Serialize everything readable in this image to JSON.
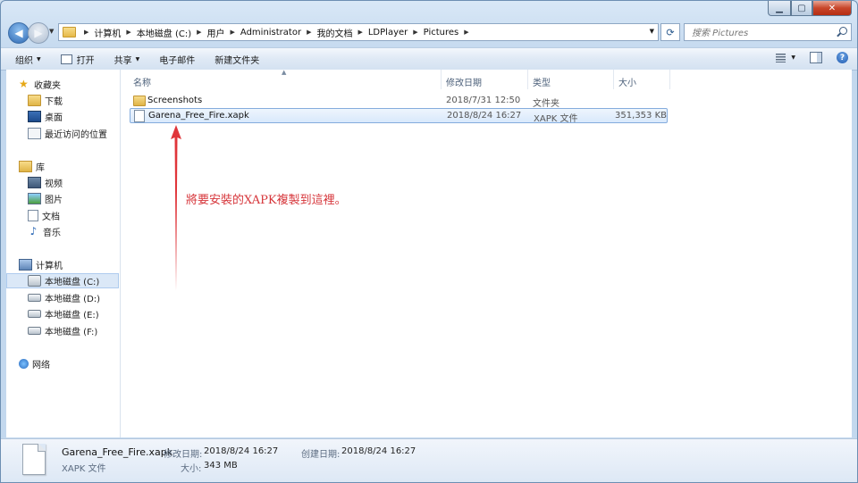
{
  "addressbar": {
    "crumbs": [
      "计算机",
      "本地磁盘 (C:)",
      "用户",
      "Administrator",
      "我的文档",
      "LDPlayer",
      "Pictures"
    ]
  },
  "search": {
    "placeholder": "搜索 Pictures"
  },
  "toolbar": {
    "organize": "组织",
    "open": "打开",
    "share": "共享",
    "email": "电子邮件",
    "new_folder": "新建文件夹"
  },
  "sidebar": {
    "favorites": "收藏夹",
    "downloads": "下载",
    "desktop": "桌面",
    "recent": "最近访问的位置",
    "libraries": "库",
    "videos": "视频",
    "pictures": "图片",
    "documents": "文档",
    "music": "音乐",
    "computer": "计算机",
    "drive_c": "本地磁盘 (C:)",
    "drive_d": "本地磁盘 (D:)",
    "drive_e": "本地磁盘 (E:)",
    "drive_f": "本地磁盘 (F:)",
    "network": "网络"
  },
  "columns": {
    "name": "名称",
    "date": "修改日期",
    "type": "类型",
    "size": "大小"
  },
  "files": [
    {
      "name": "Screenshots",
      "date": "2018/7/31 12:50",
      "type": "文件夹",
      "size": ""
    },
    {
      "name": "Garena_Free_Fire.xapk",
      "date": "2018/8/24 16:27",
      "type": "XAPK 文件",
      "size": "351,353 KB"
    }
  ],
  "annotation": "將要安裝的XAPK複製到這裡。",
  "details": {
    "name": "Garena_Free_Fire.xapk",
    "type": "XAPK 文件",
    "modified_label": "修改日期:",
    "modified": "2018/8/24 16:27",
    "size_label": "大小:",
    "size": "343 MB",
    "created_label": "创建日期:",
    "created": "2018/8/24 16:27"
  },
  "colors": {
    "annotation": "#d6353a",
    "selection": "#d9e9fc"
  }
}
